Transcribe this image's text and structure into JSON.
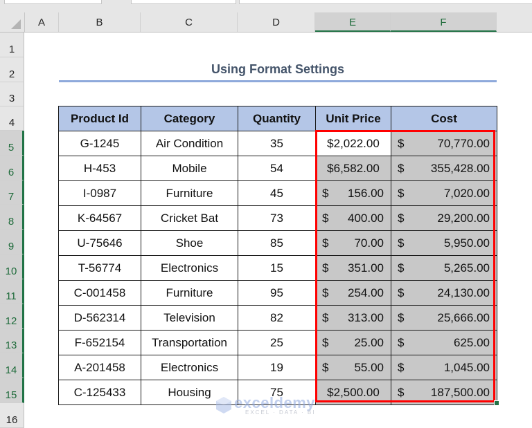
{
  "sheet": {
    "column_headers": [
      "A",
      "B",
      "C",
      "D",
      "E",
      "F"
    ],
    "selected_columns": [
      "E",
      "F"
    ],
    "row_headers": [
      "1",
      "2",
      "3",
      "4",
      "5",
      "6",
      "7",
      "8",
      "9",
      "10",
      "11",
      "12",
      "13",
      "14",
      "15",
      "16"
    ],
    "selected_rows": [
      "5",
      "6",
      "7",
      "8",
      "9",
      "10",
      "11",
      "12",
      "13",
      "14",
      "15"
    ]
  },
  "title": "Using Format Settings",
  "table": {
    "headers": [
      "Product Id",
      "Category",
      "Quantity",
      "Unit Price",
      "Cost"
    ],
    "rows": [
      {
        "product_id": "G-1245",
        "category": "Air Condition",
        "quantity": "35",
        "unit_price": "$2,022.00",
        "unit_price_style": "plain",
        "cost": "70,770.00"
      },
      {
        "product_id": "H-453",
        "category": "Mobile",
        "quantity": "54",
        "unit_price": "$6,582.00",
        "unit_price_style": "plain",
        "cost": "355,428.00"
      },
      {
        "product_id": "I-0987",
        "category": "Furniture",
        "quantity": "45",
        "unit_price": "156.00",
        "unit_price_style": "accounting",
        "cost": "7,020.00"
      },
      {
        "product_id": "K-64567",
        "category": "Cricket Bat",
        "quantity": "73",
        "unit_price": "400.00",
        "unit_price_style": "accounting",
        "cost": "29,200.00"
      },
      {
        "product_id": "U-75646",
        "category": "Shoe",
        "quantity": "85",
        "unit_price": "70.00",
        "unit_price_style": "accounting",
        "cost": "5,950.00"
      },
      {
        "product_id": "T-56774",
        "category": "Electronics",
        "quantity": "15",
        "unit_price": "351.00",
        "unit_price_style": "accounting",
        "cost": "5,265.00"
      },
      {
        "product_id": "C-001458",
        "category": "Furniture",
        "quantity": "95",
        "unit_price": "254.00",
        "unit_price_style": "accounting",
        "cost": "24,130.00"
      },
      {
        "product_id": "D-562314",
        "category": "Television",
        "quantity": "82",
        "unit_price": "313.00",
        "unit_price_style": "accounting",
        "cost": "25,666.00"
      },
      {
        "product_id": "F-652154",
        "category": "Transportation",
        "quantity": "25",
        "unit_price": "25.00",
        "unit_price_style": "accounting",
        "cost": "625.00"
      },
      {
        "product_id": "A-201458",
        "category": "Electronics",
        "quantity": "19",
        "unit_price": "55.00",
        "unit_price_style": "accounting",
        "cost": "1,045.00"
      },
      {
        "product_id": "C-125433",
        "category": "Housing",
        "quantity": "75",
        "unit_price": "$2,500.00",
        "unit_price_style": "plain",
        "cost": "187,500.00"
      }
    ],
    "currency_symbol": "$"
  },
  "selection": {
    "range": "E5:F15",
    "active_cell": "E5",
    "highlight_color": "#ff0000"
  },
  "colors": {
    "header_fill": "#b4c6e7",
    "selected_fill": "#c8c8c8",
    "title_color": "#44546a",
    "title_underline": "#8ea9db",
    "excel_green": "#217346"
  },
  "watermark": {
    "name": "exceldemy",
    "tagline": "EXCEL · DATA · BI"
  }
}
